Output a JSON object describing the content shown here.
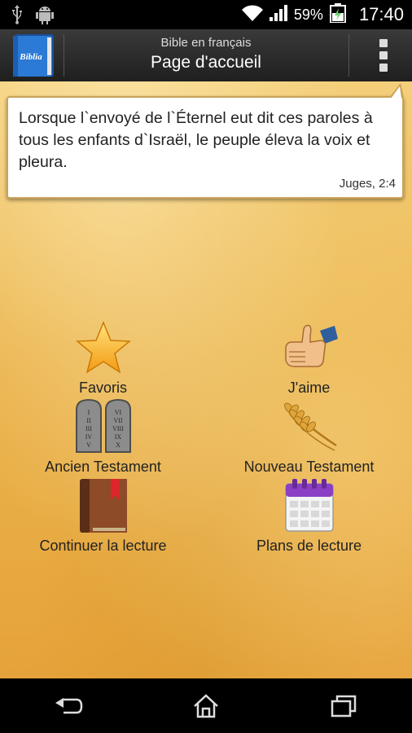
{
  "status_bar": {
    "battery": "59%",
    "time": "17:40"
  },
  "action_bar": {
    "app_icon_label": "Biblia",
    "subtitle": "Bible en français",
    "title": "Page d'accueil"
  },
  "verse": {
    "text": "Lorsque l`envoyé de l`Éternel eut dit ces paroles à tous les enfants d`Israël, le peuple éleva la voix et pleura.",
    "reference": "Juges, 2:4"
  },
  "menu": {
    "favorites": "Favoris",
    "like": "J'aime",
    "old_testament": "Ancien Testament",
    "new_testament": "Nouveau Testament",
    "continue_reading": "Continuer la lecture",
    "reading_plans": "Plans de lecture"
  },
  "tablet_numerals": {
    "left": [
      "I",
      "II",
      "III",
      "IV",
      "V"
    ],
    "right": [
      "VI",
      "VII",
      "VIII",
      "IX",
      "X"
    ]
  }
}
